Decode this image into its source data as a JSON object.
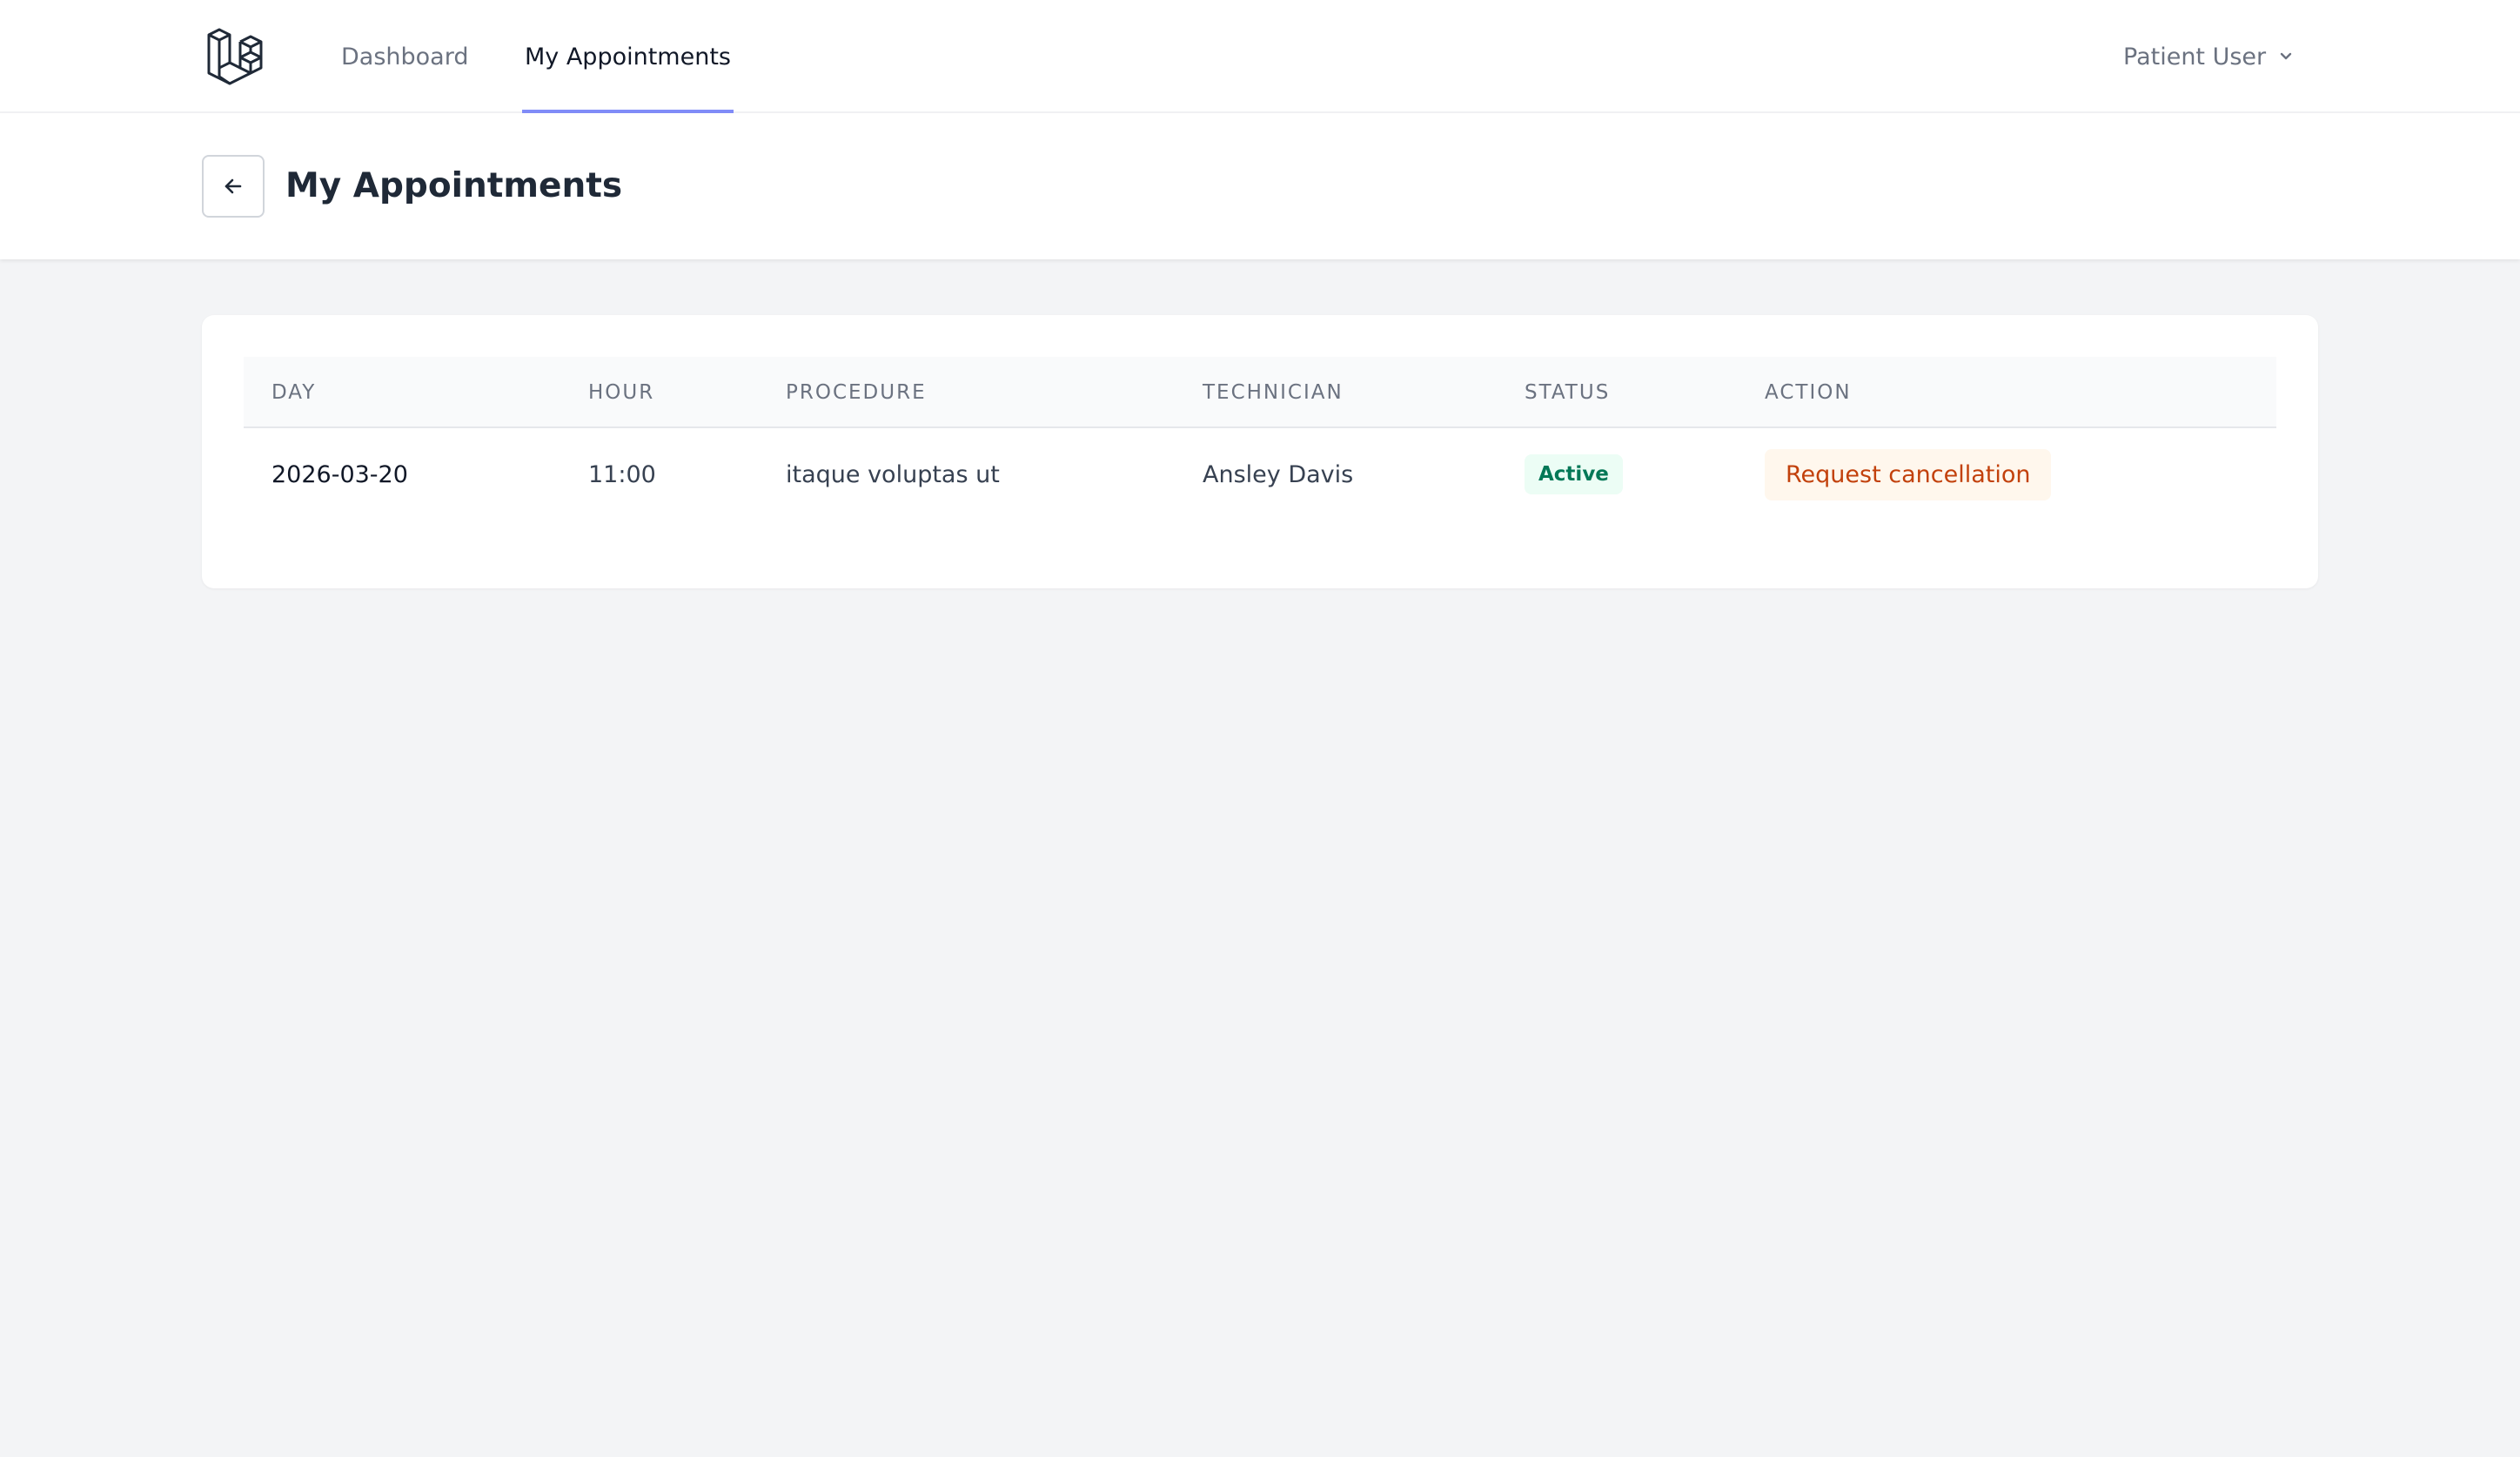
{
  "nav": {
    "links": [
      {
        "label": "Dashboard",
        "active": false
      },
      {
        "label": "My Appointments",
        "active": true
      }
    ],
    "user": {
      "name": "Patient User"
    }
  },
  "header": {
    "title": "My Appointments"
  },
  "table": {
    "columns": [
      "Day",
      "Hour",
      "Procedure",
      "Technician",
      "Status",
      "Action"
    ],
    "rows": [
      {
        "day": "2026-03-20",
        "hour": "11:00",
        "procedure": "itaque voluptas ut",
        "technician": "Ansley Davis",
        "status": "Active",
        "action": "Request cancellation"
      }
    ]
  },
  "colors": {
    "accent": "#818cf8",
    "status_active_bg": "#ecfdf5",
    "status_active_text": "#047857",
    "action_bg": "#fff7ed",
    "action_text": "#c2410c"
  },
  "icons": {
    "logo": "laravel-logo",
    "back": "arrow-left-icon",
    "user_menu": "chevron-down-icon"
  }
}
